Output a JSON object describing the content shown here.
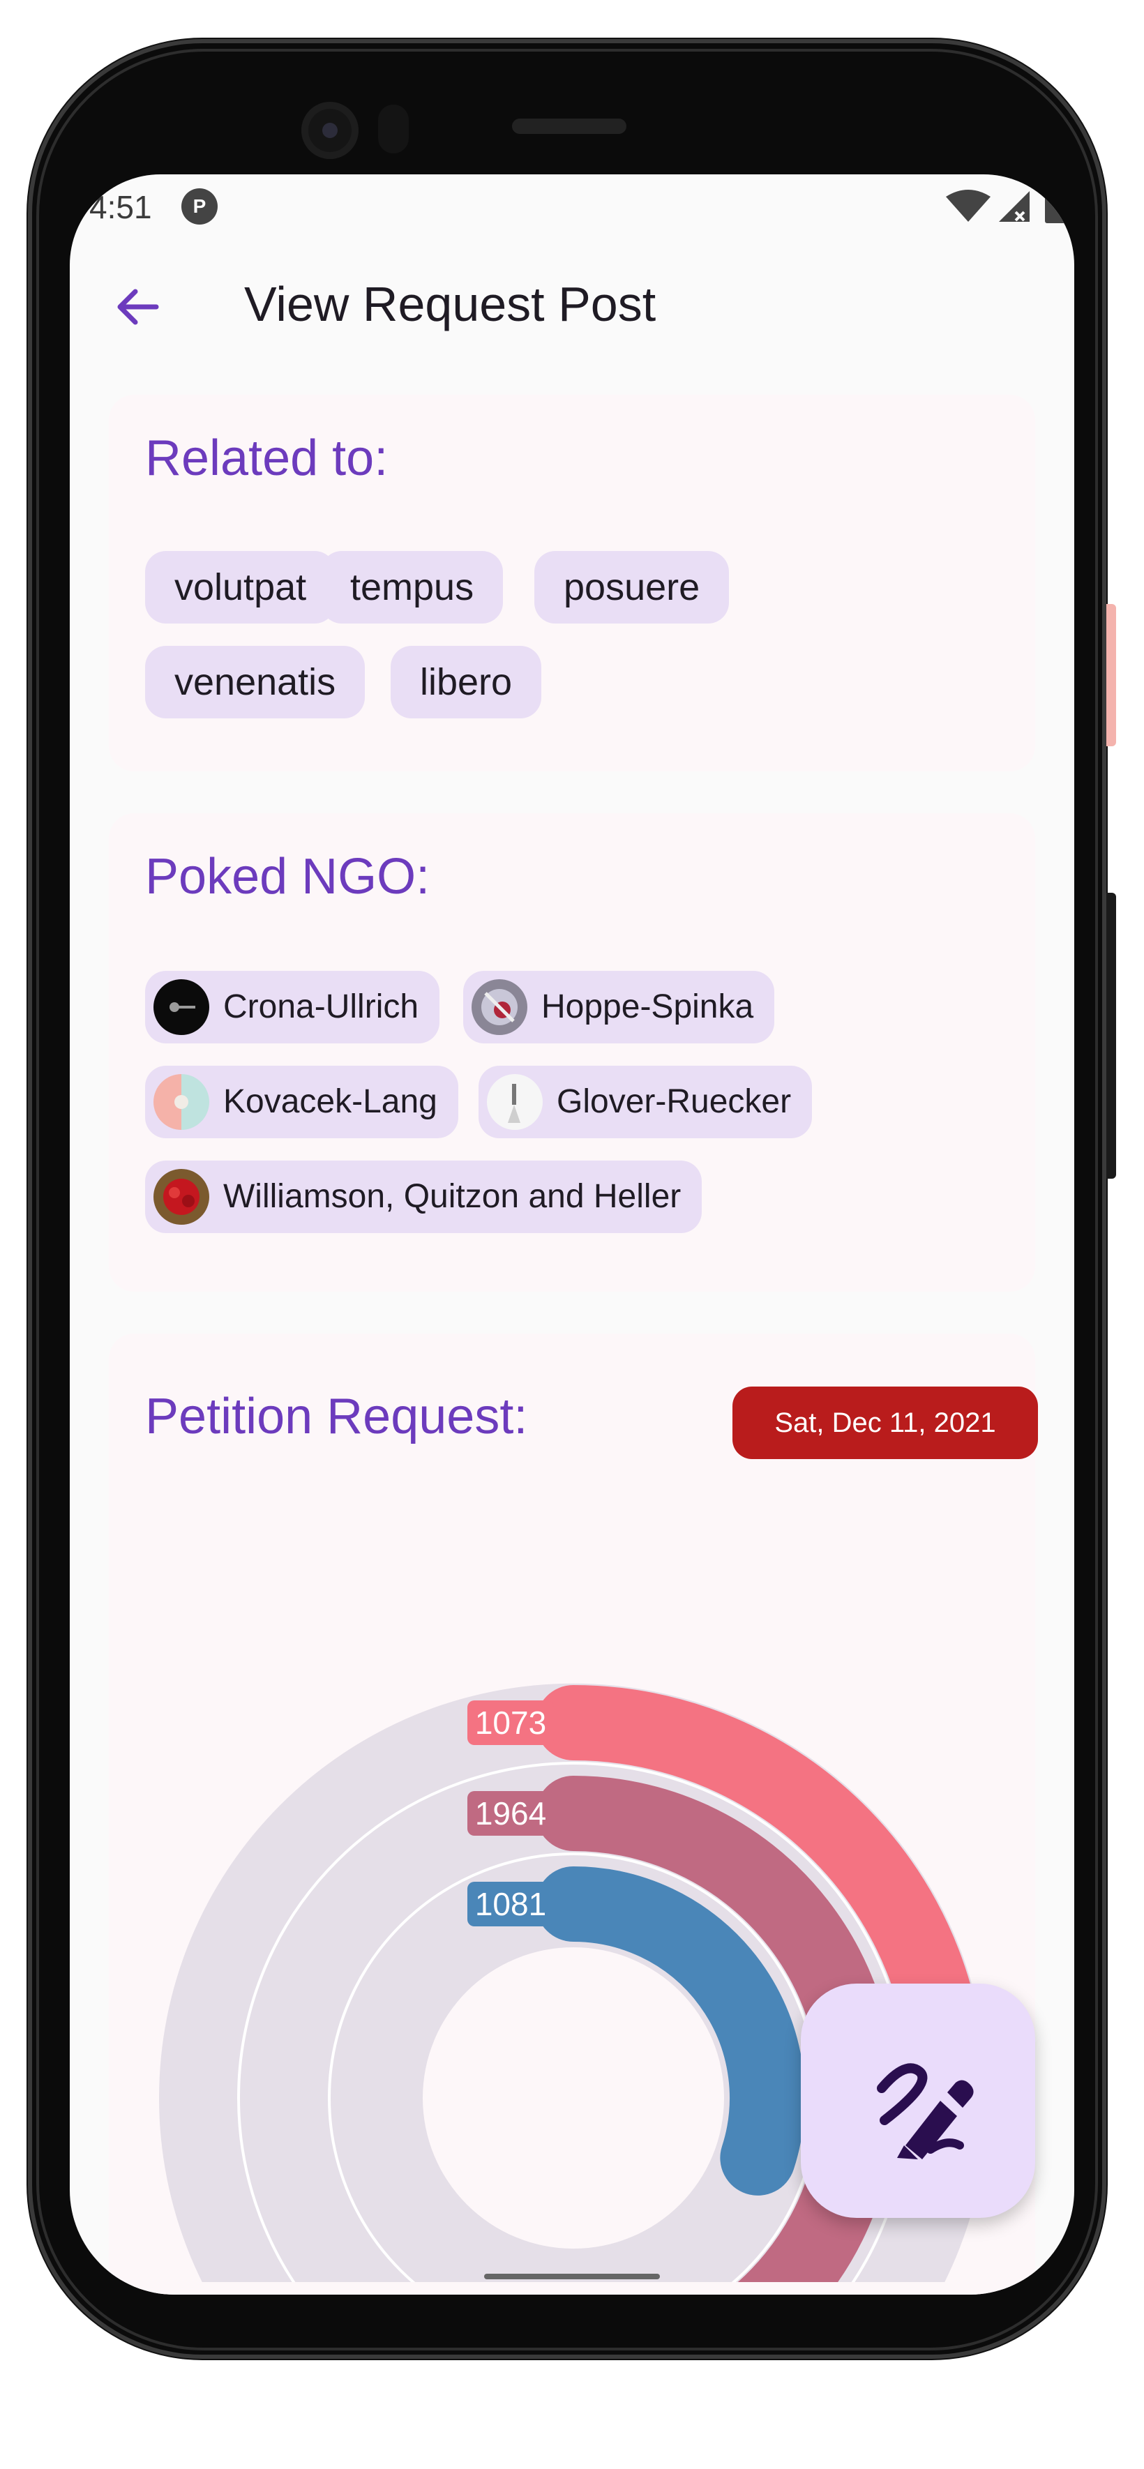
{
  "status_bar": {
    "time": "4:51",
    "badge": "P"
  },
  "app_bar": {
    "title": "View Request Post"
  },
  "related": {
    "heading": "Related to:",
    "tags": [
      "volutpat",
      "tempus",
      "posuere",
      "venenatis",
      "libero"
    ]
  },
  "poked": {
    "heading": "Poked NGO:",
    "ngos": [
      "Crona-Ullrich",
      "Hoppe-Spinka",
      "Kovacek-Lang",
      "Glover-Ruecker",
      "Williamson, Quitzon and Heller"
    ]
  },
  "petition": {
    "heading": "Petition Request:",
    "date": "Sat, Dec 11, 2021"
  },
  "colors": {
    "accent": "#6c3bbd",
    "date_badge": "#b91c1c",
    "ring_outer": "#f47382",
    "ring_middle": "#c06a82",
    "ring_inner": "#4a86b8"
  },
  "chart_data": {
    "type": "radial-bar",
    "series": [
      {
        "label": "1073",
        "value": 1073,
        "fraction": 0.27
      },
      {
        "label": "1964",
        "value": 1964,
        "fraction": 0.58
      },
      {
        "label": "1081",
        "value": 1081,
        "fraction": 0.3
      }
    ]
  }
}
